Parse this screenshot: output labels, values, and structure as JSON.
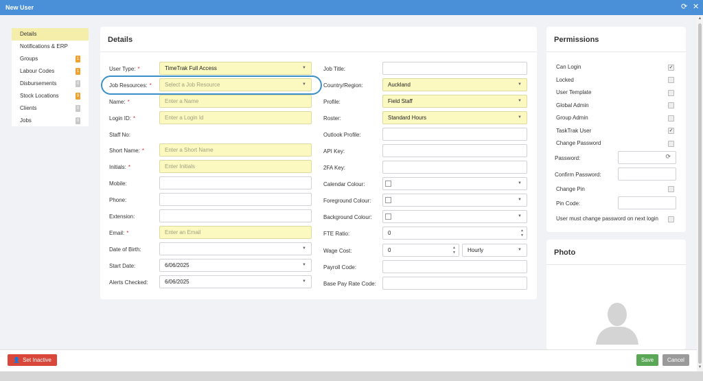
{
  "window": {
    "title": "New User",
    "refresh_icon": "refresh-icon",
    "close_icon": "close-icon"
  },
  "nav": {
    "items": [
      {
        "label": "Details",
        "badge": ""
      },
      {
        "label": "Notifications & ERP",
        "badge": ""
      },
      {
        "label": "Groups",
        "badge": "1"
      },
      {
        "label": "Labour Codes",
        "badge": "1"
      },
      {
        "label": "Disbursements",
        "badge": "0"
      },
      {
        "label": "Stock Locations",
        "badge": "9"
      },
      {
        "label": "Clients",
        "badge": "0"
      },
      {
        "label": "Jobs",
        "badge": "0"
      }
    ]
  },
  "details": {
    "title": "Details",
    "left": [
      {
        "label": "User Type:",
        "value": "TimeTrak Full Access",
        "placeholder": ""
      },
      {
        "label": "Job Resources:",
        "value": "",
        "placeholder": "Select a Job Resource"
      },
      {
        "label": "Name:",
        "value": "",
        "placeholder": "Enter a Name"
      },
      {
        "label": "Login ID:",
        "value": "",
        "placeholder": "Enter a Login Id"
      },
      {
        "label": "Staff No:",
        "value": "",
        "placeholder": ""
      },
      {
        "label": "Short Name:",
        "value": "",
        "placeholder": "Enter a Short Name"
      },
      {
        "label": "Initials:",
        "value": "",
        "placeholder": "Enter Initials"
      },
      {
        "label": "Mobile:",
        "value": "",
        "placeholder": ""
      },
      {
        "label": "Phone:",
        "value": "",
        "placeholder": ""
      },
      {
        "label": "Extension:",
        "value": "",
        "placeholder": ""
      },
      {
        "label": "Email:",
        "value": "",
        "placeholder": "Enter an Email"
      },
      {
        "label": "Date of Birth:",
        "value": "",
        "placeholder": ""
      },
      {
        "label": "Start Date:",
        "value": "6/06/2025",
        "placeholder": ""
      },
      {
        "label": "Alerts Checked:",
        "value": "6/06/2025",
        "placeholder": ""
      }
    ],
    "right": [
      {
        "label": "Job Title:",
        "value": ""
      },
      {
        "label": "Country/Region:",
        "value": "Auckland"
      },
      {
        "label": "Profile:",
        "value": "Field Staff"
      },
      {
        "label": "Roster:",
        "value": "Standard Hours"
      },
      {
        "label": "Outlook Profile:",
        "value": ""
      },
      {
        "label": "API Key:",
        "value": ""
      },
      {
        "label": "2FA Key:",
        "value": ""
      },
      {
        "label": "Calendar Colour:",
        "value": ""
      },
      {
        "label": "Foreground Colour:",
        "value": ""
      },
      {
        "label": "Background Colour:",
        "value": ""
      },
      {
        "label": "FTE Ratio:",
        "value": "0"
      },
      {
        "label": "Wage Cost:",
        "value": "0",
        "unit": "Hourly"
      },
      {
        "label": "Payroll Code:",
        "value": ""
      },
      {
        "label": "Base Pay Rate Code:",
        "value": ""
      }
    ]
  },
  "permissions": {
    "title": "Permissions",
    "checks": [
      {
        "label": "Can Login",
        "checked": true
      },
      {
        "label": "Locked",
        "checked": false
      },
      {
        "label": "User Template",
        "checked": false
      },
      {
        "label": "Global Admin",
        "checked": false
      },
      {
        "label": "Group Admin",
        "checked": false
      },
      {
        "label": "TaskTrak User",
        "checked": true
      },
      {
        "label": "Change Password",
        "checked": false
      }
    ],
    "password_label": "Password:",
    "confirm_password_label": "Confirm Password:",
    "change_pin_label": "Change Pin",
    "pin_code_label": "Pin Code:",
    "must_change_label": "User must change password on next login"
  },
  "photo": {
    "title": "Photo"
  },
  "actions": {
    "set_inactive": "Set Inactive",
    "save": "Save",
    "cancel": "Cancel"
  },
  "colors": {
    "accent": "#4a90d9",
    "required_field": "#fbf8c0",
    "danger": "#d9473a",
    "success": "#5aa856"
  }
}
